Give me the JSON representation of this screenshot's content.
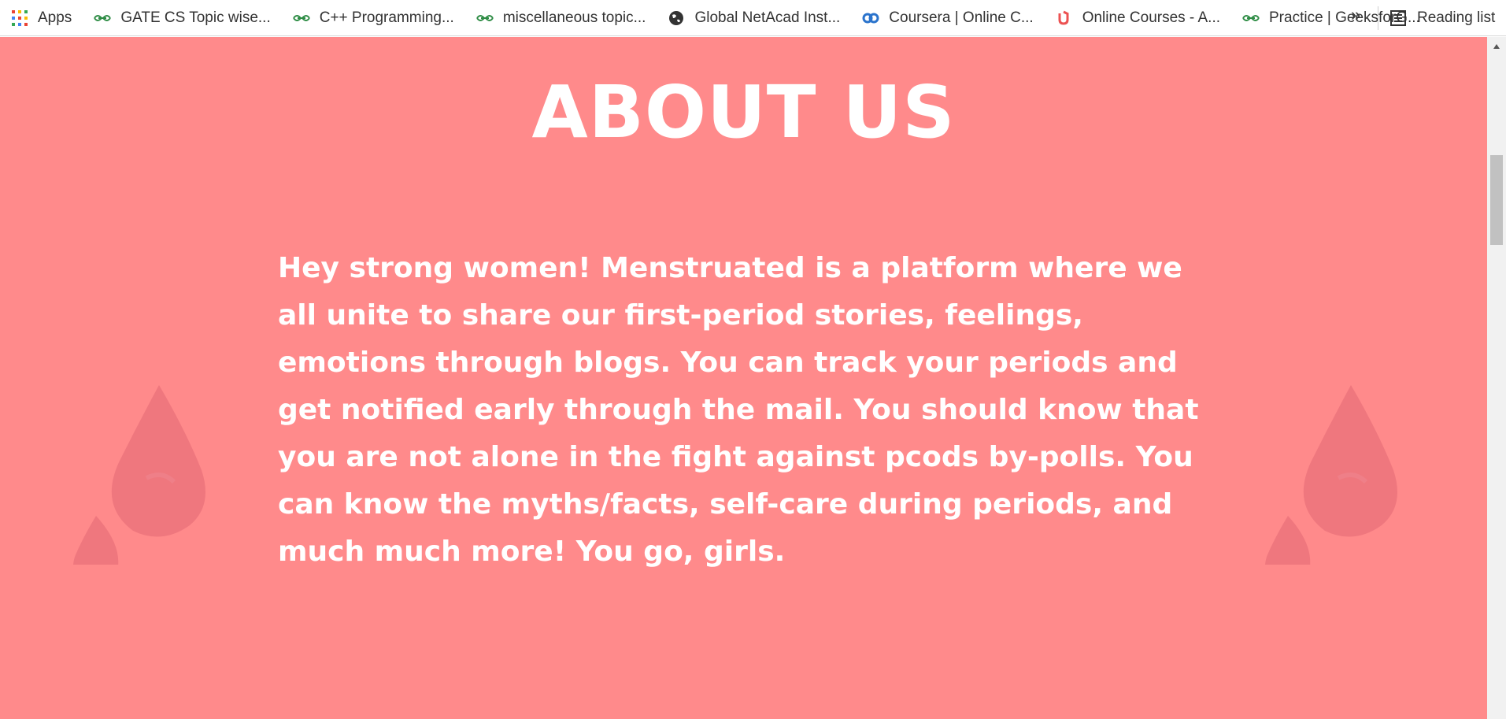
{
  "bookmarks": {
    "apps_label": "Apps",
    "items": [
      {
        "label": "GATE CS Topic wise...",
        "icon": "geeksforgeeks-icon"
      },
      {
        "label": "C++ Programming...",
        "icon": "geeksforgeeks-icon"
      },
      {
        "label": "miscellaneous topic...",
        "icon": "geeksforgeeks-icon"
      },
      {
        "label": "Global NetAcad Inst...",
        "icon": "globe-icon"
      },
      {
        "label": "Coursera | Online C...",
        "icon": "coursera-icon"
      },
      {
        "label": "Online Courses - A...",
        "icon": "udemy-icon"
      },
      {
        "label": "Practice | GeeksforG...",
        "icon": "geeksforgeeks-icon"
      }
    ],
    "overflow_label": "»",
    "reading_list_label": "Reading list"
  },
  "page": {
    "title": "ABOUT US",
    "about_text": "Hey strong women! Menstruated is a platform where we all unite to share our first-period stories, feelings, emotions through blogs. You can track your periods and get notified early through the mail. You should know that you are not alone in the fight against pcods by-polls. You can know the myths/facts, self-care during periods, and much much more! You go, girls."
  },
  "colors": {
    "background": "#ff8a8b",
    "drop": "#e9707a",
    "text": "#ffffff"
  }
}
